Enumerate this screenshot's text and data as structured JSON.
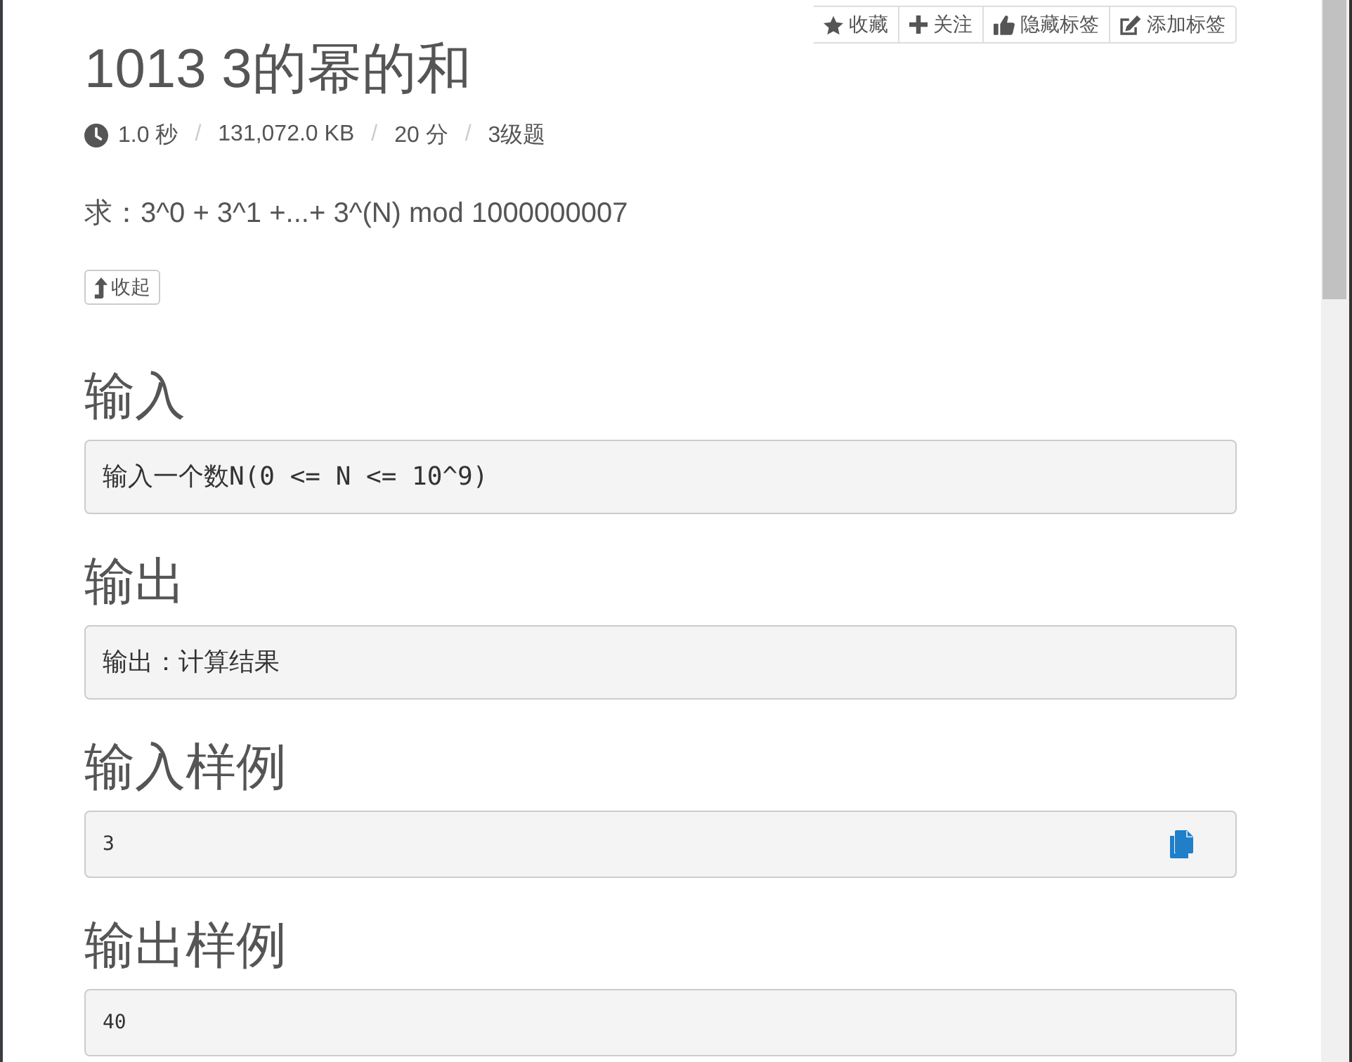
{
  "toolbar": [
    {
      "kind": "star",
      "label": "收藏"
    },
    {
      "kind": "plus",
      "label": "关注"
    },
    {
      "kind": "thumbs-up",
      "label": "隐藏标签"
    },
    {
      "kind": "edit",
      "label": "添加标签"
    }
  ],
  "title": "1013 3的幂的和",
  "meta": {
    "items": [
      {
        "kind": "time",
        "text": "1.0 秒"
      },
      {
        "kind": "memory",
        "text": "131,072.0 KB"
      },
      {
        "kind": "score",
        "text": "20 分"
      },
      {
        "kind": "difficulty",
        "text": "3级题"
      }
    ],
    "separators": [
      "/",
      "/",
      "/"
    ]
  },
  "statement": "求：3^0 + 3^1 +...+ 3^(N) mod 1000000007",
  "collapse_button": {
    "label": "收起"
  },
  "sections": [
    {
      "kind": "text",
      "heading": "输入",
      "content": "输入一个数N(0 <= N <= 10^9)",
      "copyable": false
    },
    {
      "kind": "text",
      "heading": "输出",
      "content": "输出：计算结果",
      "copyable": false
    },
    {
      "kind": "sample",
      "heading": "输入样例",
      "content": "3",
      "copyable": true
    },
    {
      "kind": "sample",
      "heading": "输出样例",
      "content": "40",
      "copyable": false
    }
  ]
}
